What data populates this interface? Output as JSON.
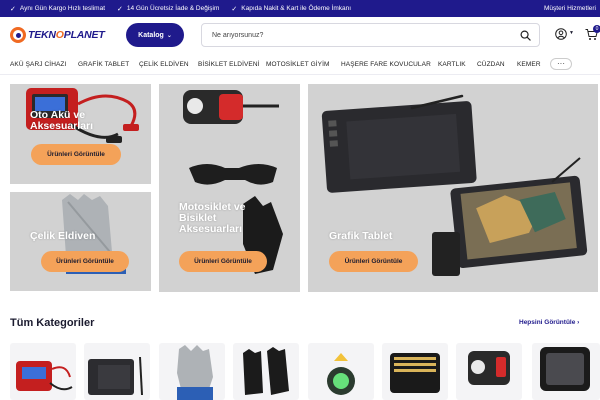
{
  "topbar": {
    "items": [
      "Aynı Gün Kargo Hızlı teslimat",
      "14 Gün Ücretsiz İade & Değişim",
      "Kapıda Nakit & Kart ile Ödeme İmkanı"
    ],
    "help": "Müşteri Hizmetleri"
  },
  "header": {
    "logo": {
      "part1": "TEKN",
      "o": "O",
      "part2": "PLANET"
    },
    "catalog_label": "Katalog",
    "search_placeholder": "Ne arıyorsunuz?",
    "cart_count": "0"
  },
  "categories": [
    "AKÜ ŞARJ CİHAZI",
    "GRAFİK TABLET",
    "ÇELİK ELDİVEN",
    "BİSİKLET ELDİVENİ",
    "MOTOSİKLET GİYİM",
    "HAŞERE FARE KOVUCULAR",
    "KARTLIK",
    "CÜZDAN",
    "KEMER"
  ],
  "more_label": "···",
  "banners": [
    {
      "title": "Oto Akü ve Aksesuarları",
      "button": "Ürünleri Görüntüle"
    },
    {
      "title": "Çelik Eldiven",
      "button": "Ürünleri Görüntüle"
    },
    {
      "title": "Motosiklet ve Bisiklet Aksesuarları",
      "button": "Ürünleri Görüntüle"
    },
    {
      "title": "Grafik Tablet",
      "button": "Ürünleri Görüntüle"
    }
  ],
  "section": {
    "title": "Tüm Kategoriler",
    "see_all": "Hepsini Görüntüle ›"
  },
  "colors": {
    "brand": "#1f1a8c",
    "accent": "#f06a22",
    "button": "#f4a259"
  }
}
